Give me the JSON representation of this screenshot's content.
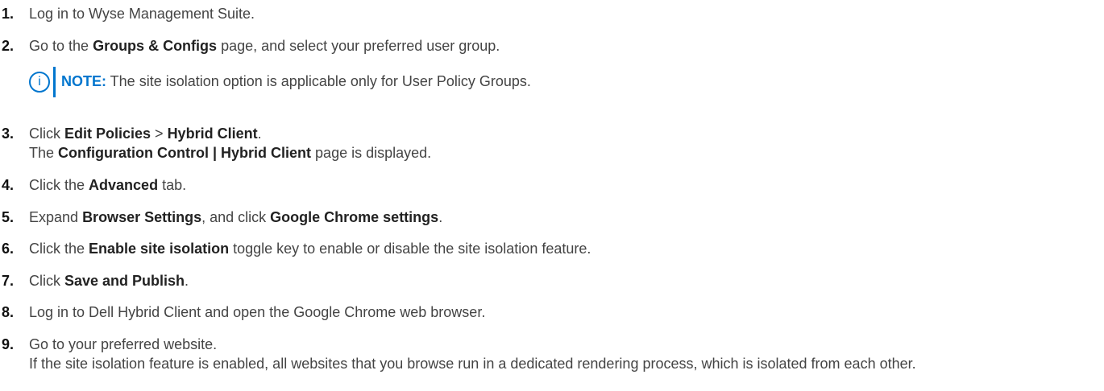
{
  "steps": [
    {
      "num": "1.",
      "parts": [
        "Log in to Wyse Management Suite."
      ]
    },
    {
      "num": "2.",
      "parts": [
        "Go to the ",
        "Groups & Configs",
        " page, and select your preferred user group."
      ]
    },
    {
      "num": "3.",
      "parts": [
        "Click ",
        "Edit Policies",
        " > ",
        "Hybrid Client",
        "."
      ],
      "result": [
        "The ",
        "Configuration Control | Hybrid Client",
        " page is displayed."
      ]
    },
    {
      "num": "4.",
      "parts": [
        "Click the ",
        "Advanced",
        " tab."
      ]
    },
    {
      "num": "5.",
      "parts": [
        "Expand ",
        "Browser Settings",
        ", and click ",
        "Google Chrome settings",
        "."
      ]
    },
    {
      "num": "6.",
      "parts": [
        "Click the ",
        "Enable site isolation",
        " toggle key to enable or disable the site isolation feature."
      ]
    },
    {
      "num": "7.",
      "parts": [
        "Click ",
        "Save and Publish",
        "."
      ]
    },
    {
      "num": "8.",
      "parts": [
        "Log in to Dell Hybrid Client and open the Google Chrome web browser."
      ]
    },
    {
      "num": "9.",
      "parts": [
        "Go to your preferred website."
      ],
      "result": [
        "If the site isolation feature is enabled, all websites that you browse run in a dedicated rendering process, which is isolated from each other."
      ]
    }
  ],
  "note": {
    "icon": "info-icon",
    "icon_glyph": "i",
    "label": "NOTE:",
    "text": " The site isolation option is applicable only for User Policy Groups."
  },
  "colors": {
    "accent": "#0076ce",
    "text": "#444444"
  }
}
